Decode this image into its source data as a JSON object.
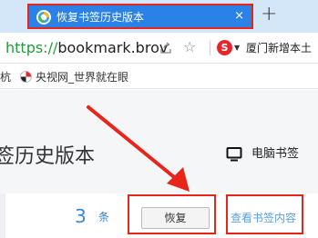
{
  "tab": {
    "title": "恢复书签历史版本",
    "close_glyph": "×",
    "new_tab_glyph": "+"
  },
  "address_bar": {
    "url_scheme": "https://",
    "url_rest": "bookmark.brov",
    "search_engine_label": "S",
    "search_text": "厦门新增本土"
  },
  "bookmarks_bar": {
    "partial_item": "杭",
    "items": [
      {
        "label": "央视网_世界就在眼",
        "icon": "cctv-icon"
      }
    ]
  },
  "page": {
    "title": "签历史版本",
    "pc_bookmark_label": "电脑书签",
    "record": {
      "count": "3",
      "count_unit": "条",
      "restore_label": "恢复",
      "view_label": "查看书签内容"
    }
  },
  "colors": {
    "tab_active": "#2b82e6",
    "highlight": "#e8251b",
    "link": "#3b86d6"
  }
}
